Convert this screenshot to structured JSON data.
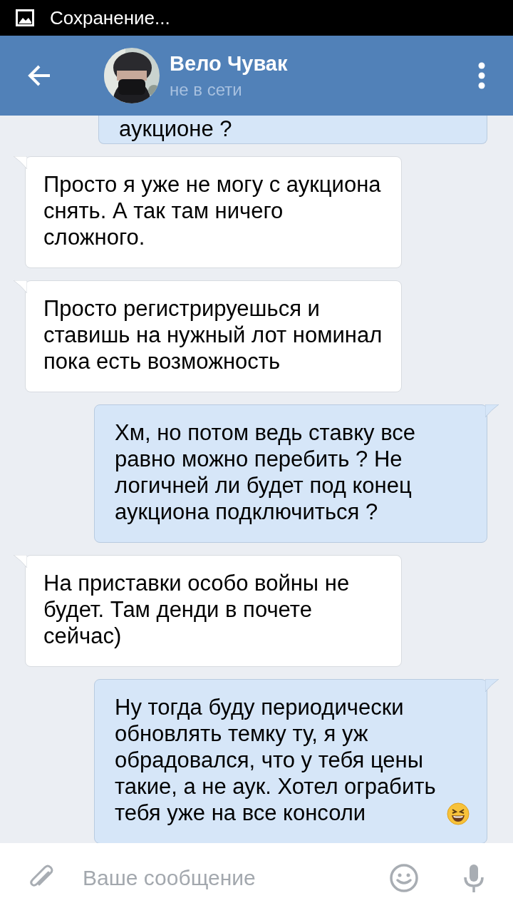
{
  "status_bar": {
    "notification": "Сохранение..."
  },
  "header": {
    "name": "Вело Чувак",
    "status": "не в сети"
  },
  "messages": [
    {
      "kind": "outgoing",
      "text": "аукционе ?"
    },
    {
      "kind": "incoming",
      "text": "Просто я уже не могу с аукциона снять. А так там ничего сложного."
    },
    {
      "kind": "incoming",
      "text": "Просто регистрируешься и ставишь на нужный лот номинал пока есть возможность"
    },
    {
      "kind": "outgoing",
      "text": "Хм, но потом ведь ставку все равно можно перебить ? Не логичней ли будет под конец аукциона подключиться ?"
    },
    {
      "kind": "incoming",
      "text": "На приставки особо войны не будет. Там денди в почете сейчас)"
    },
    {
      "kind": "outgoing",
      "text": "Ну тогда буду периодически обновлять темку ту, я уж обрадовался, что у тебя цены такие, а не аук. Хотел ограбить тебя уже на все консоли",
      "emoji": {
        "kind": "laughing"
      }
    }
  ],
  "composer": {
    "placeholder": "Ваше сообщение"
  }
}
